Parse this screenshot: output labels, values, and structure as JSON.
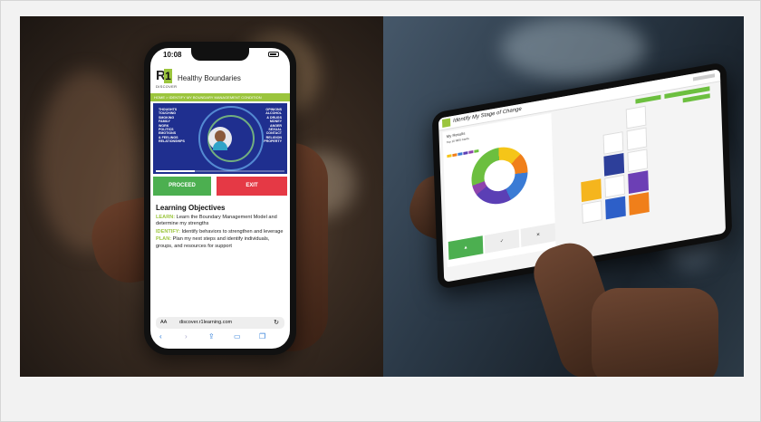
{
  "left_photo": {
    "phone": {
      "status_time": "10:08",
      "app_title": "Healthy Boundaries",
      "logo_letters": "R1",
      "logo_sub": "DISCOVER",
      "breadcrumb": "HOME > IDENTIFY MY BOUNDARY MANAGEMENT CONDITION",
      "video_words_left": [
        "THOUGHTS",
        "TOUCHING",
        "SMOKING",
        "FAMILY",
        "WORK",
        "POLITICS",
        "EMOTIONS",
        "& FEELINGS",
        "RELATIONSHIPS"
      ],
      "video_words_right": [
        "OPINIONS",
        "ALCOHOL",
        "& DRUGS",
        "MONEY",
        "ANGER",
        "SEXUAL",
        "CONTACT",
        "RELIGION",
        "PROPERTY"
      ],
      "buttons": {
        "proceed": "PROCEED",
        "exit": "EXIT"
      },
      "heading": "Learning Objectives",
      "objectives": [
        {
          "key": "LEARN:",
          "text": "Learn the Boundary Management Model and determine my strengths"
        },
        {
          "key": "IDENTIFY:",
          "text": "Identify behaviors to strengthen and leverage"
        },
        {
          "key": "PLAN:",
          "text": "Plan my next steps and identify individuals, groups, and resources for support"
        }
      ],
      "url_aa": "AA",
      "url": "discover.r1learning.com",
      "safari_icons": [
        "back-icon",
        "forward-icon",
        "share-icon",
        "bookmarks-icon",
        "tabs-icon"
      ],
      "colors": {
        "accent": "#9bc53d",
        "proceed": "#4caf50",
        "exit": "#e53945",
        "video_bg": "#1f2f8f"
      }
    }
  },
  "right_photo": {
    "tablet": {
      "title": "Identify My Stage of Change",
      "panel_title": "My Results",
      "panel_subtitle": "Top 10 RES Cards",
      "donut_colors": [
        "#f5c518",
        "#f07f1a",
        "#3a7bd5",
        "#5b3fb5",
        "#8e44ad",
        "#6cbf3f"
      ],
      "cards_label": "Top 10 RES Cards",
      "action_buttons": [
        "✓",
        "✕"
      ],
      "colors": {
        "accent": "#6cbf3f"
      }
    }
  }
}
